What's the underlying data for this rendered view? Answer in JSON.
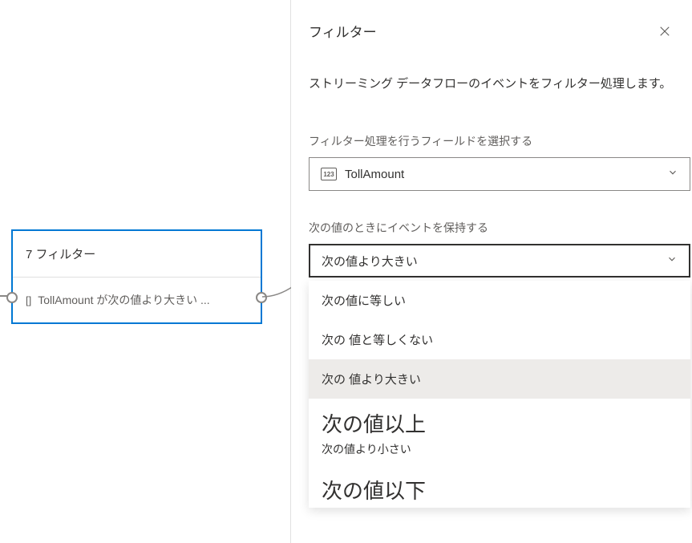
{
  "panel": {
    "title": "フィルター",
    "description": "ストリーミング データフローのイベントをフィルター処理します。",
    "close_label": "閉じる"
  },
  "fieldSelect": {
    "label": "フィルター処理を行うフィールドを選択する",
    "value": "TollAmount",
    "iconText": "123"
  },
  "conditionSelect": {
    "label": "次の値のときにイベントを保持する",
    "value": "次の値より大きい",
    "options": [
      {
        "text": "次の値に等しい"
      },
      {
        "text": "次の 値と等しくない"
      },
      {
        "text": "次の 値より大きい"
      },
      {
        "text": "次の値以上"
      },
      {
        "text": "次の値より小さい"
      },
      {
        "text": "次の値以下"
      }
    ]
  },
  "node": {
    "title": "7 フィルター",
    "description": "TollAmount が次の値より大きい ...",
    "icon": "[]"
  }
}
